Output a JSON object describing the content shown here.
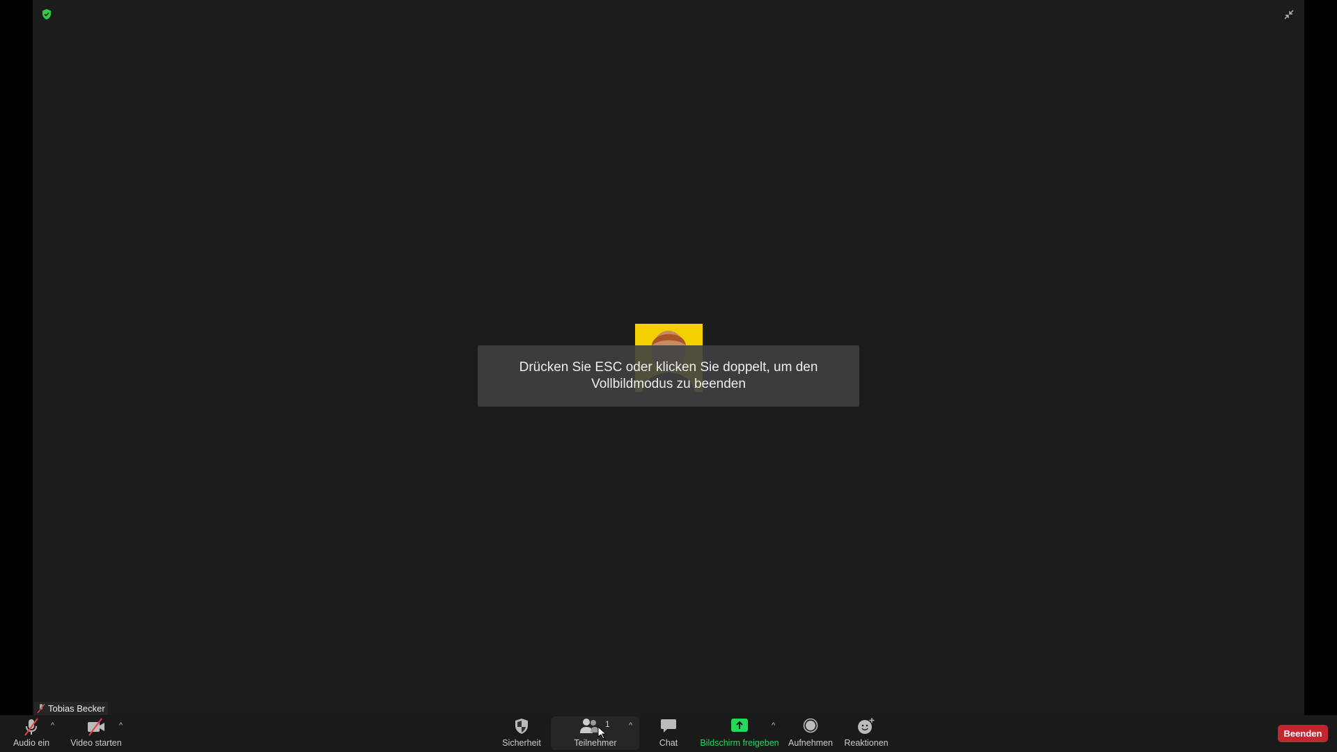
{
  "toast": {
    "line1": "Drücken Sie ESC oder klicken Sie doppelt, um den",
    "line2": "Vollbildmodus zu beenden"
  },
  "participant": {
    "name": "Tobias Becker",
    "muted": true
  },
  "toolbar": {
    "audio": "Audio ein",
    "video": "Video starten",
    "security": "Sicherheit",
    "participants": "Teilnehmer",
    "participants_count": "1",
    "chat": "Chat",
    "share": "Bildschirm freigeben",
    "record": "Aufnehmen",
    "reactions": "Reaktionen",
    "end": "Beenden"
  },
  "colors": {
    "share_green": "#23d959",
    "end_red": "#c2262e",
    "encryption_green": "#2ecc40",
    "avatar_bg": "#f5d000"
  }
}
